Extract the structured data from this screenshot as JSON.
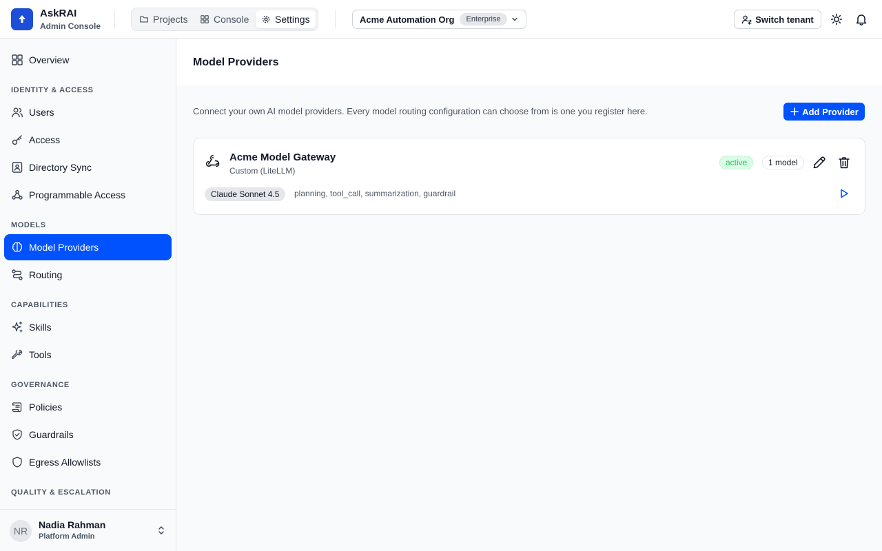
{
  "brand": {
    "title": "AskRAI",
    "subtitle": "Admin Console",
    "accent": "#0052ff"
  },
  "nav_tabs": [
    {
      "label": "Projects",
      "icon": "folder-icon",
      "active": false
    },
    {
      "label": "Console",
      "icon": "grid-icon",
      "active": false
    },
    {
      "label": "Settings",
      "icon": "gear-icon",
      "active": true
    }
  ],
  "org": {
    "name": "Acme Automation Org",
    "plan": "Enterprise"
  },
  "header_actions": {
    "switch_tenant": "Switch tenant",
    "theme_icon": "sun-icon",
    "notify_icon": "bell-icon"
  },
  "sidebar": {
    "overview": "Overview",
    "groups": {
      "identity": "IDENTITY & ACCESS",
      "models": "MODELS",
      "capabilities": "CAPABILITIES",
      "governance": "GOVERNANCE",
      "quality": "QUALITY & ESCALATION"
    },
    "items": {
      "users": "Users",
      "access": "Access",
      "directory_sync": "Directory Sync",
      "programmable_access": "Programmable Access",
      "model_providers": "Model Providers",
      "routing": "Routing",
      "skills": "Skills",
      "tools": "Tools",
      "policies": "Policies",
      "guardrails": "Guardrails",
      "egress": "Egress Allowlists"
    },
    "active": "model_providers"
  },
  "user": {
    "initials": "NR",
    "name": "Nadia Rahman",
    "role": "Platform Admin"
  },
  "main": {
    "title": "Model Providers",
    "intro": "Connect your own AI model providers. Every model routing configuration can choose from is one you register here.",
    "add_button": "Add Provider",
    "providers": [
      {
        "name": "Acme Model Gateway",
        "type": "Custom (LiteLLM)",
        "status": "active",
        "model_count": "1 model",
        "model": "Claude Sonnet 4.5",
        "capabilities": "planning, tool_call, summarization, guardrail"
      }
    ]
  }
}
